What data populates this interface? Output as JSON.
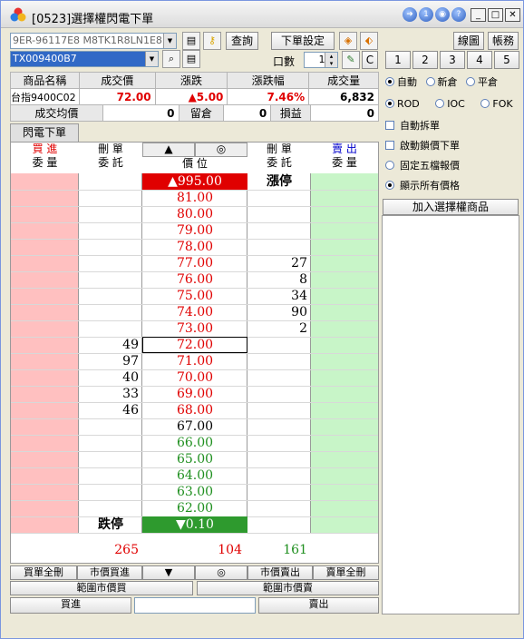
{
  "window": {
    "title": "[0523]選擇權閃電下單"
  },
  "toolbar": {
    "account_value": "9ER-96117E8  M8TK1R8LN1E8",
    "query_label": "查詢",
    "order_settings_label": "下單設定",
    "chart_label": "線圖",
    "account_label": "帳務",
    "product_code": "TX009400B7",
    "lots_label": "口數",
    "lots_value": "1",
    "clear_label": "C",
    "quick_qty": [
      "1",
      "2",
      "3",
      "4",
      "5"
    ]
  },
  "info": {
    "headers": [
      "商品名稱",
      "成交價",
      "漲跌",
      "漲跌幅",
      "成交量"
    ],
    "values": {
      "name": "台指9400C02",
      "price": "72.00",
      "change": "▲5.00",
      "change_pct": "7.46%",
      "volume": "6,832"
    },
    "row2": {
      "avg_label": "成交均價",
      "avg_value": "0",
      "position_label": "留倉",
      "position_value": "0",
      "pnl_label": "損益",
      "pnl_value": "0"
    }
  },
  "tab": {
    "label": "閃電下單"
  },
  "ladder": {
    "headers": {
      "buy_qty_line1": "買 進",
      "buy_qty_line2": "委 量",
      "del_buy_line1": "刪 單",
      "del_buy_line2": "委 託",
      "up_arrow": "▲",
      "center_icon": "◎",
      "price_label": "價 位",
      "del_sell_line1": "刪 單",
      "del_sell_line2": "委 託",
      "sell_qty_line1": "賣 出",
      "sell_qty_line2": "委 量"
    },
    "limit_up_label": "漲停",
    "limit_down_label": "跌停",
    "prices": [
      "▲995.00",
      "81.00",
      "80.00",
      "79.00",
      "78.00",
      "77.00",
      "76.00",
      "75.00",
      "74.00",
      "73.00",
      "72.00",
      "71.00",
      "70.00",
      "69.00",
      "68.00",
      "67.00",
      "66.00",
      "65.00",
      "64.00",
      "63.00",
      "62.00",
      "▼0.10"
    ],
    "sell_orders": {
      "5": "27",
      "6": "8",
      "7": "34",
      "8": "90",
      "9": "2"
    },
    "buy_orders": {
      "10": "49",
      "11": "97",
      "12": "40",
      "13": "33",
      "14": "46"
    },
    "totals": {
      "buy": "265",
      "mid": "104",
      "sell": "161"
    }
  },
  "bottom": {
    "row1": [
      "買單全刪",
      "市價買進",
      "▼",
      "◎",
      "市價賣出",
      "賣單全刪"
    ],
    "row2": [
      "範圍市價買",
      "範圍市價賣"
    ],
    "row3": [
      "買進",
      "",
      "賣出"
    ]
  },
  "right_panel": {
    "order_type": [
      "自動",
      "新倉",
      "平倉"
    ],
    "time_in_force": [
      "ROD",
      "IOC",
      "FOK"
    ],
    "checks": [
      "自動拆單",
      "啟動鎖價下單",
      "固定五檔報價",
      "顯示所有價格"
    ],
    "add_product_label": "加入選擇權商品"
  },
  "colors": {
    "buy_bg": "#ffc0c0",
    "sell_bg": "#c8f5c8",
    "limit_up_bg": "#e00000",
    "limit_down_bg": "#2e9a2e"
  }
}
